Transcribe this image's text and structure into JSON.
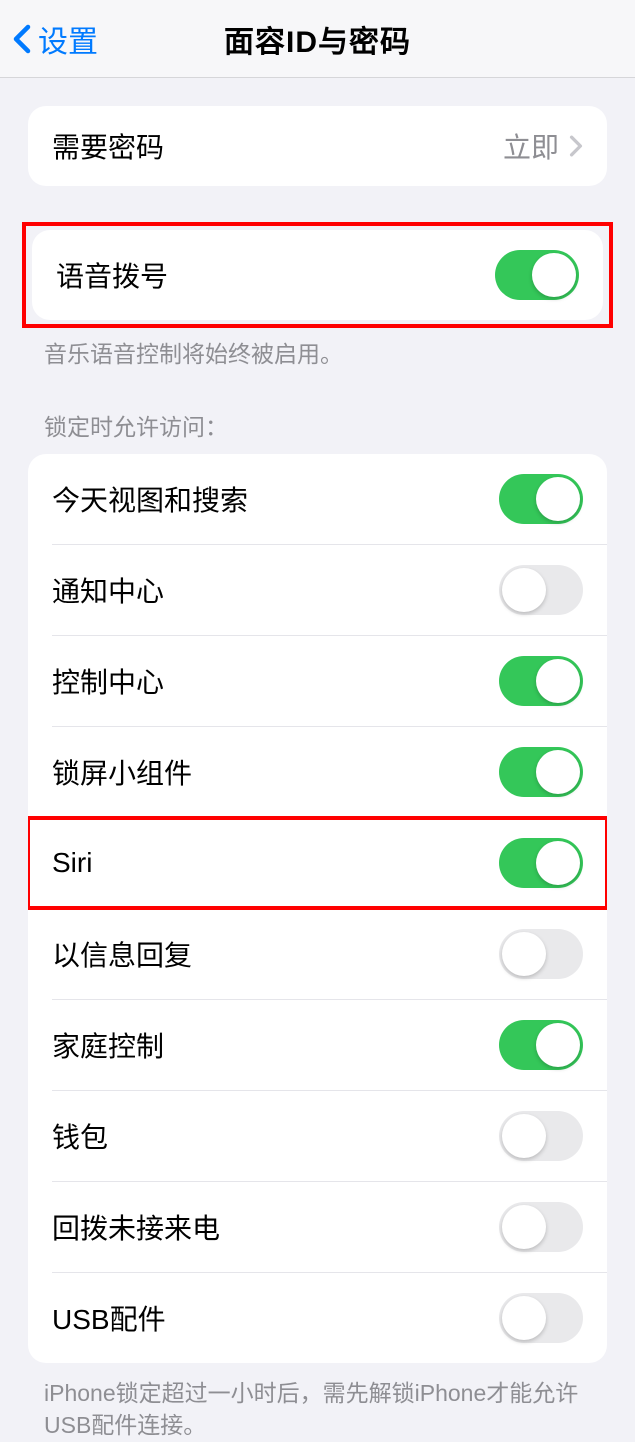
{
  "header": {
    "back_label": "设置",
    "title": "面容ID与密码"
  },
  "require_passcode": {
    "label": "需要密码",
    "value": "立即"
  },
  "voice_dial": {
    "label": "语音拨号",
    "on": true,
    "footer": "音乐语音控制将始终被启用。"
  },
  "allow_access_header": "锁定时允许访问：",
  "allow_access": {
    "items": [
      {
        "label": "今天视图和搜索",
        "on": true
      },
      {
        "label": "通知中心",
        "on": false
      },
      {
        "label": "控制中心",
        "on": true
      },
      {
        "label": "锁屏小组件",
        "on": true
      },
      {
        "label": "Siri",
        "on": true
      },
      {
        "label": "以信息回复",
        "on": false
      },
      {
        "label": "家庭控制",
        "on": true
      },
      {
        "label": "钱包",
        "on": false
      },
      {
        "label": "回拨未接来电",
        "on": false
      },
      {
        "label": "USB配件",
        "on": false
      }
    ],
    "footer": "iPhone锁定超过一小时后，需先解锁iPhone才能允许USB配件连接。"
  }
}
